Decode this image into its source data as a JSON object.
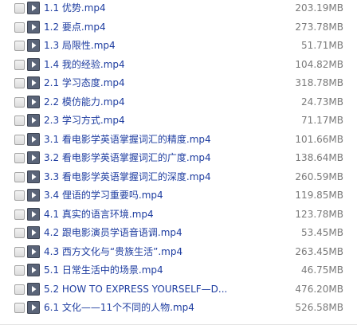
{
  "files": [
    {
      "name": "1.1 优势.mp4",
      "size": "203.19MB"
    },
    {
      "name": "1.2 要点.mp4",
      "size": "273.78MB"
    },
    {
      "name": "1.3 局限性.mp4",
      "size": "51.71MB"
    },
    {
      "name": "1.4 我的经验.mp4",
      "size": "104.82MB"
    },
    {
      "name": "2.1 学习态度.mp4",
      "size": "318.78MB"
    },
    {
      "name": "2.2 模仿能力.mp4",
      "size": "24.73MB"
    },
    {
      "name": "2.3 学习方式.mp4",
      "size": "71.17MB"
    },
    {
      "name": "3.1 看电影学英语掌握词汇的精度.mp4",
      "size": "101.66MB"
    },
    {
      "name": "3.2 看电影学英语掌握词汇的广度.mp4",
      "size": "138.64MB"
    },
    {
      "name": "3.3 看电影学英语掌握词汇的深度.mp4",
      "size": "260.59MB"
    },
    {
      "name": "3.4 俚语的学习重要吗.mp4",
      "size": "119.85MB"
    },
    {
      "name": "4.1 真实的语言环境.mp4",
      "size": "123.78MB"
    },
    {
      "name": "4.2 跟电影演员学语音语调.mp4",
      "size": "53.45MB"
    },
    {
      "name": "4.3 西方文化与“贵族生活”.mp4",
      "size": "263.45MB"
    },
    {
      "name": "5.1 日常生活中的场景.mp4",
      "size": "46.75MB"
    },
    {
      "name": "5.2 HOW TO EXPRESS YOURSELF—D...",
      "size": "476.20MB"
    },
    {
      "name": "6.1 文化——11个不同的人物.mp4",
      "size": "526.58MB"
    }
  ]
}
